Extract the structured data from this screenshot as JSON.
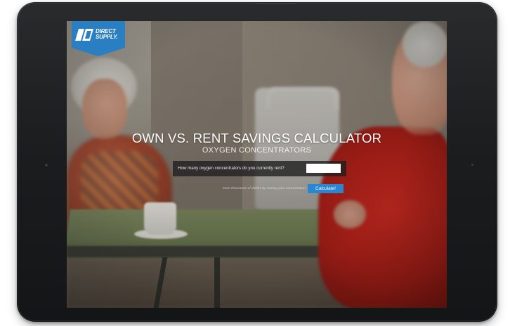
{
  "brand": {
    "logo_line1": "DIRECT",
    "logo_line2": "SUPPLY.",
    "logo_color": "#2a7ec2"
  },
  "calculator": {
    "title": "OWN VS. RENT SAVINGS CALCULATOR",
    "subtitle": "OXYGEN CONCENTRATORS",
    "question": "How many oxygen concentrators do you currently rent?",
    "input_value": "",
    "hint": "Save thousands of dollars by owning your concentrators",
    "button_label": "Calculate!",
    "button_color": "#2b86d1"
  },
  "icons": {
    "logo": "direct-supply-logo-icon"
  }
}
